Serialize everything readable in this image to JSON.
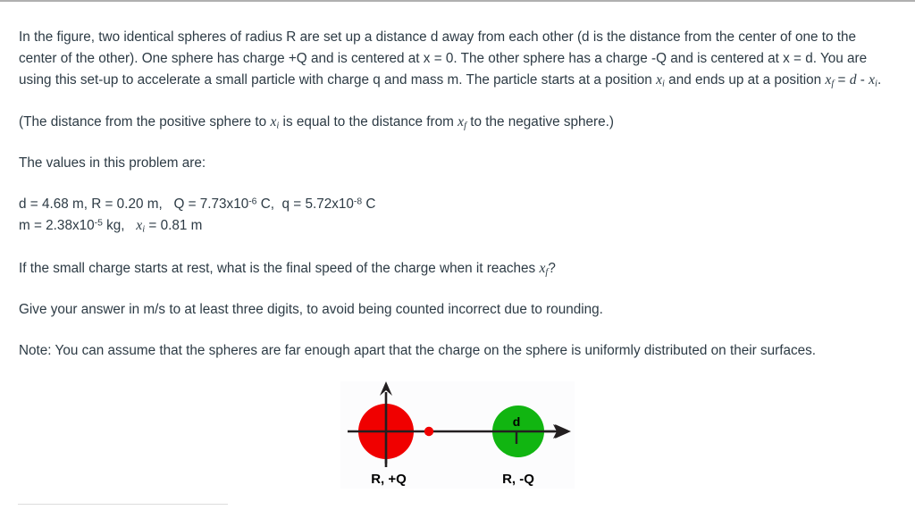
{
  "problem": {
    "paragraph_1_parts": {
      "t1": "In the figure, two identical spheres of radius R are set up a distance d away from each other (d is the distance from the center of one to the center of the other). One sphere has charge +Q and is centered at x = 0. The other sphere has a charge -Q and is centered at x = d. You are using this set-up to accelerate a small particle with charge q and mass m. The particle starts at a position ",
      "xi_1": "x",
      "xi_1_sub": "i",
      "t2": " and ends up at a position ",
      "xf_1": "x",
      "xf_1_sub": "f",
      "t3": " = ",
      "d_ital": "d",
      "t4": " - ",
      "xi_2": "x",
      "xi_2_sub": "i",
      "t5": "."
    },
    "paragraph_2_parts": {
      "t1": "(The distance from the positive sphere to ",
      "xi": "x",
      "xi_sub": "i",
      "t2": " is equal to the distance from ",
      "xf": "x",
      "xf_sub": "f",
      "t3": " to the negative sphere.)"
    },
    "values_intro": "The values in this problem are:",
    "values_line_1": {
      "d_label": "d = 4.68 m, R = 0.20 m,   Q = 7.73x10",
      "q_exp": "-6",
      "mid": " C,  q = 5.72x10",
      "q2_exp": "-8",
      "tail": " C"
    },
    "values_line_2": {
      "m_label": "m = 2.38x10",
      "m_exp": "-5",
      "mid": " kg,   ",
      "xi": "x",
      "xi_sub": "i",
      "tail": " = 0.81 m"
    },
    "paragraph_3_parts": {
      "t1": "If the small charge starts at rest, what is the final speed of the charge when it reaches ",
      "xf": "x",
      "xf_sub": "f",
      "t2": "?"
    },
    "paragraph_4": "Give your answer in m/s to at least three digits, to avoid being counted incorrect due to rounding.",
    "paragraph_5": "Note: You can assume that the spheres are far enough apart that the charge on the sphere is uniformly distributed on their surfaces."
  },
  "figure": {
    "positive_sphere": {
      "label": "R, +Q",
      "color": "#f00000",
      "radius_px": 31
    },
    "negative_sphere": {
      "label": "R, -Q",
      "color": "#11b511",
      "radius_px": 29,
      "center_label": "d"
    },
    "particle": {
      "color": "#f00000",
      "name": "small-charge-q"
    },
    "axis_color": "#231f20",
    "background": "#fcfcfd"
  },
  "values": {
    "d": "4.68 m",
    "R": "0.20 m",
    "Q": "7.73x10^-6 C",
    "q": "5.72x10^-8 C",
    "m": "2.38x10^-5 kg",
    "x_i": "0.81 m"
  }
}
